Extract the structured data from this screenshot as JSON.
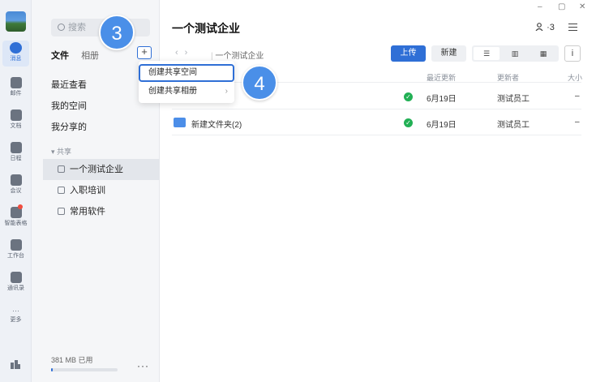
{
  "rail": {
    "items": [
      {
        "label": "消息",
        "icon": "message-icon"
      },
      {
        "label": "邮件",
        "icon": "mail-icon"
      },
      {
        "label": "文档",
        "icon": "docs-icon"
      },
      {
        "label": "日程",
        "icon": "calendar-icon"
      },
      {
        "label": "会议",
        "icon": "meeting-icon"
      },
      {
        "label": "智能表格",
        "icon": "smart-sheet-icon"
      },
      {
        "label": "工作台",
        "icon": "workbench-icon"
      },
      {
        "label": "通讯录",
        "icon": "contacts-icon"
      },
      {
        "label": "更多",
        "icon": "more-icon"
      }
    ]
  },
  "sidebar": {
    "search_placeholder": "搜索",
    "tabs": [
      "文件",
      "相册"
    ],
    "plus": "+",
    "nav": [
      "最近查看",
      "我的空间",
      "我分享的"
    ],
    "section": "▾ 共享",
    "shared": [
      "一个测试企业",
      "入职培训",
      "常用软件"
    ],
    "storage": "381 MB 已用",
    "more": "···"
  },
  "main": {
    "window_controls": [
      "–",
      "▢",
      "✕"
    ],
    "title": "一个测试企业",
    "members": "3",
    "breadcrumb": "一个测试企业",
    "upload": "上传",
    "new": "新建",
    "info": "i",
    "columns": {
      "updated": "最近更新",
      "updater": "更新者",
      "size": "大小"
    },
    "rows": [
      {
        "name": "",
        "updated": "6月19日",
        "updater": "测试员工",
        "size": "–"
      },
      {
        "name": "新建文件夹(2)",
        "updated": "6月19日",
        "updater": "测试员工",
        "size": "–"
      }
    ]
  },
  "dropdown": {
    "items": [
      "创建共享空间",
      "创建共享相册"
    ]
  },
  "badges": [
    "3",
    "4"
  ],
  "colors": {
    "accent": "#2f6fd6",
    "badge": "#4a8fe8",
    "success": "#22b055"
  }
}
